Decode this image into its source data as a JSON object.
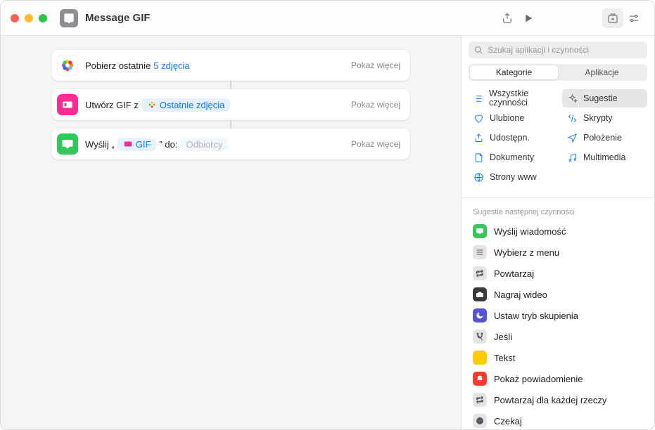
{
  "header": {
    "title": "Message GIF"
  },
  "search": {
    "placeholder": "Szukaj aplikacji i czynności"
  },
  "segmented": {
    "categories": "Kategorie",
    "apps": "Aplikacje"
  },
  "categories": {
    "all": "Wszystkie czynności",
    "favorites": "Ulubione",
    "sharing": "Udostępn.",
    "documents": "Dokumenty",
    "web": "Strony www",
    "suggestions": "Sugestie",
    "scripting": "Skrypty",
    "location": "Położenie",
    "media": "Multimedia"
  },
  "steps": {
    "s1": {
      "prefix": "Pobierz ostatnie",
      "token": "5 zdjęcia",
      "more": "Pokaż więcej"
    },
    "s2": {
      "prefix": "Utwórz GIF z",
      "token": "Ostatnie zdjęcia",
      "more": "Pokaż więcej"
    },
    "s3": {
      "prefix1": "Wyślij „",
      "gif": "GIF",
      "prefix2": "” do:",
      "placeholder": "Odbiorcy",
      "more": "Pokaż więcej"
    }
  },
  "suggestions_title": "Sugestie następnej czynności",
  "actions": [
    {
      "label": "Wyślij wiadomość",
      "color": "#34c759",
      "icon": "message"
    },
    {
      "label": "Wybierz z menu",
      "color": "#8e8e93",
      "icon": "menu"
    },
    {
      "label": "Powtarzaj",
      "color": "#8e8e93",
      "icon": "repeat"
    },
    {
      "label": "Nagraj wideo",
      "color": "#3a3a3c",
      "icon": "camera"
    },
    {
      "label": "Ustaw tryb skupienia",
      "color": "#5856d6",
      "icon": "moon"
    },
    {
      "label": "Jeśli",
      "color": "#8e8e93",
      "icon": "branch"
    },
    {
      "label": "Tekst",
      "color": "#ffcc00",
      "icon": "text"
    },
    {
      "label": "Pokaż powiadomienie",
      "color": "#ff3b30",
      "icon": "bell"
    },
    {
      "label": "Powtarzaj dla każdej rzeczy",
      "color": "#8e8e93",
      "icon": "repeat"
    },
    {
      "label": "Czekaj",
      "color": "#8e8e93",
      "icon": "clock"
    }
  ]
}
